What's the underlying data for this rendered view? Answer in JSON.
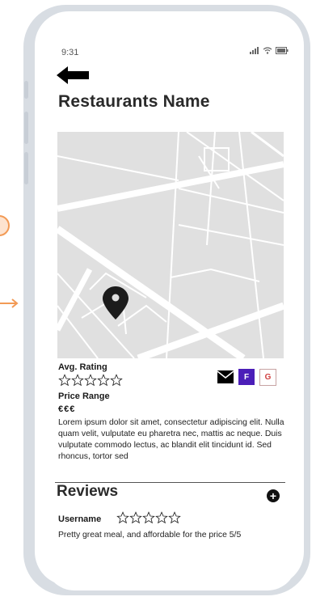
{
  "status": {
    "time": "9:31"
  },
  "restaurant": {
    "name": "Restaurants Name",
    "rating_label": "Avg. Rating",
    "rating_stars": 5,
    "price_label": "Price Range",
    "price_value": "€€€",
    "description": "Lorem ipsum dolor sit amet, consectetur adipiscing elit. Nulla quam velit, vulputate eu pharetra nec, mattis ac neque. Duis vulputate commodo lectus, ac blandit elit tincidunt id. Sed rhoncus, tortor sed"
  },
  "share": {
    "facebook_label": "F",
    "google_label": "G"
  },
  "reviews": {
    "title": "Reviews",
    "add_label": "+",
    "items": [
      {
        "username": "Username",
        "stars": 5,
        "text": "Pretty great meal, and affordable for the price 5/5"
      }
    ]
  },
  "icons": {
    "back": "back-arrow-icon",
    "mail": "mail-icon",
    "pin": "map-pin-icon",
    "star": "star-outline-icon"
  },
  "colors": {
    "frame": "#d8dde3",
    "map_bg": "#e0e0e0",
    "facebook": "#4b1eb8",
    "google": "#d04141",
    "annotation": "#f29a55"
  }
}
